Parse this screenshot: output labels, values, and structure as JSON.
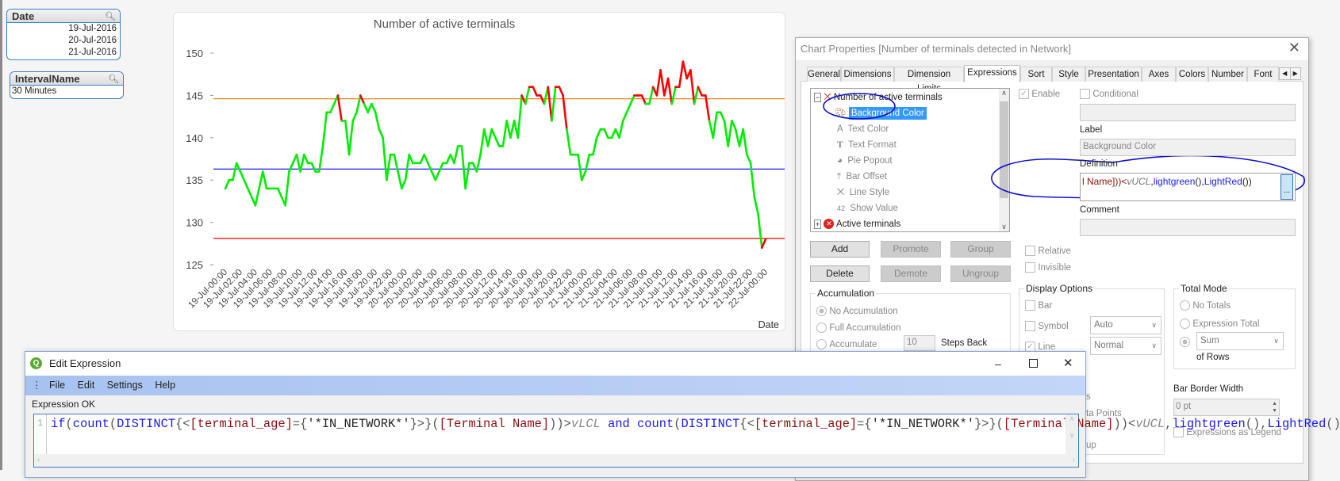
{
  "listboxes": [
    {
      "title": "Date",
      "items": [
        "19-Jul-2016",
        "20-Jul-2016",
        "21-Jul-2016"
      ]
    },
    {
      "title": "IntervalName",
      "items": [
        "30 Minutes"
      ]
    }
  ],
  "chart_data": {
    "type": "line",
    "title": "Number of active terminals",
    "xlabel": "Date",
    "ylabel": "",
    "ylim": [
      125,
      150
    ],
    "yticks": [
      125,
      130,
      135,
      140,
      145,
      150
    ],
    "grid": false,
    "x_tick_labels": [
      "19-Jul-00:00",
      "19-Jul-02:00",
      "19-Jul-04:00",
      "19-Jul-06:00",
      "19-Jul-08:00",
      "19-Jul-10:00",
      "19-Jul-12:00",
      "19-Jul-14:00",
      "19-Jul-16:00",
      "19-Jul-18:00",
      "19-Jul-20:00",
      "19-Jul-22:00",
      "20-Jul-00:00",
      "20-Jul-02:00",
      "20-Jul-04:00",
      "20-Jul-06:00",
      "20-Jul-08:00",
      "20-Jul-10:00",
      "20-Jul-12:00",
      "20-Jul-14:00",
      "20-Jul-16:00",
      "20-Jul-18:00",
      "20-Jul-20:00",
      "20-Jul-22:00",
      "21-Jul-00:00",
      "21-Jul-02:00",
      "21-Jul-04:00",
      "21-Jul-06:00",
      "21-Jul-08:00",
      "21-Jul-10:00",
      "21-Jul-12:00",
      "21-Jul-14:00",
      "21-Jul-16:00",
      "21-Jul-18:00",
      "21-Jul-20:00",
      "21-Jul-22:00",
      "22-Jul-00:00"
    ],
    "values": [
      134,
      135,
      135,
      137,
      136,
      135,
      134,
      133,
      132,
      134,
      136,
      134,
      134,
      134,
      134,
      133,
      132,
      136,
      137,
      138,
      136,
      138,
      137,
      137,
      136,
      136,
      139,
      143,
      143,
      144,
      145,
      142,
      142,
      138,
      142,
      143,
      145,
      144,
      143,
      144,
      143,
      141,
      140,
      135,
      138,
      138,
      136,
      134,
      135,
      138,
      137,
      137,
      137,
      138,
      137,
      136,
      135,
      136,
      137,
      137,
      138,
      137,
      139,
      139,
      134,
      137,
      137,
      136,
      138,
      141,
      139,
      141,
      140,
      139,
      139,
      142,
      140,
      142,
      140,
      145,
      144,
      146,
      146,
      145,
      145,
      144,
      146,
      142,
      146,
      146,
      145,
      141,
      138,
      138,
      138,
      135,
      136,
      138,
      138,
      140,
      141,
      141,
      140,
      140,
      141,
      140,
      142,
      143,
      144,
      145,
      145,
      145,
      144,
      144,
      146,
      145,
      148,
      145,
      147,
      144,
      146,
      146,
      149,
      147,
      148,
      144,
      146,
      145,
      145,
      142,
      140,
      143,
      143,
      142,
      139,
      142,
      141,
      139,
      141,
      138,
      137,
      133,
      131,
      127,
      128
    ],
    "reference_lines": [
      {
        "value": 144.6,
        "color": "#f07800"
      },
      {
        "value": 136.3,
        "color": "#0000ff"
      },
      {
        "value": 128.1,
        "color": "#e00000"
      }
    ],
    "colors": {
      "in_range": "#00ee00",
      "out_of_range": "#ff0000"
    }
  },
  "dialog": {
    "title": "Chart Properties [Number of terminals detected in Network]",
    "tabs": [
      "General",
      "Dimensions",
      "Dimension Limits",
      "Expressions",
      "Sort",
      "Style",
      "Presentation",
      "Axes",
      "Colors",
      "Number",
      "Font"
    ],
    "selected_tab": "Expressions",
    "tree": {
      "root": "Number of active terminals",
      "children": [
        "Background Color",
        "Text Color",
        "Text Format",
        "Pie Popout",
        "Bar Offset",
        "Line Style",
        "Show Value"
      ],
      "selected": "Background Color",
      "other": "Active terminals"
    },
    "enable_label": "Enable",
    "conditional_label": "Conditional",
    "label_label": "Label",
    "label_value": "Background Color",
    "definition_label": "Definition",
    "definition_visible": {
      "a": "l Name]))<",
      "b": "vUCL",
      ",": ",",
      "c": "lightgreen",
      "d": "()",
      ",2": ",",
      "e": "LightRed",
      "f": "())"
    },
    "definition_button": "...",
    "comment_label": "Comment",
    "buttons": {
      "add": "Add",
      "promote": "Promote",
      "group": "Group",
      "delete": "Delete",
      "demote": "Demote",
      "ungroup": "Ungroup"
    },
    "relative_label": "Relative",
    "invisible_label": "Invisible",
    "accumulation": {
      "title": "Accumulation",
      "no": "No Accumulation",
      "full": "Full Accumulation",
      "acc": "Accumulate",
      "steps": "10",
      "steps_label": "Steps Back"
    },
    "display_options": {
      "title": "Display Options",
      "bar": "Bar",
      "symbol": "Symbol",
      "symbol_value": "Auto",
      "line": "Line",
      "line_value": "Normal",
      "partial1": "s",
      "partial2": "ta Points",
      "partial3": "up"
    },
    "total_mode": {
      "title": "Total Mode",
      "no_totals": "No Totals",
      "expr_total": "Expression Total",
      "sum": "Sum",
      "of_rows": "of Rows"
    },
    "bar_border_label": "Bar Border Width",
    "bar_border_value": "0 pt",
    "expr_legend_label": "Expressions as Legend"
  },
  "edit_expression": {
    "title": "Edit Expression",
    "menu": [
      "File",
      "Edit",
      "Settings",
      "Help"
    ],
    "status": "Expression OK",
    "line_number": "1",
    "expression": "if(count(DISTINCT{<[terminal_age]={'*IN_NETWORK*'}>}([Terminal Name]))>vLCL and count(DISTINCT{<[terminal_age]={'*IN_NETWORK*'}>}([Terminal Name]))<vUCL,lightgreen(),LightRed())"
  }
}
